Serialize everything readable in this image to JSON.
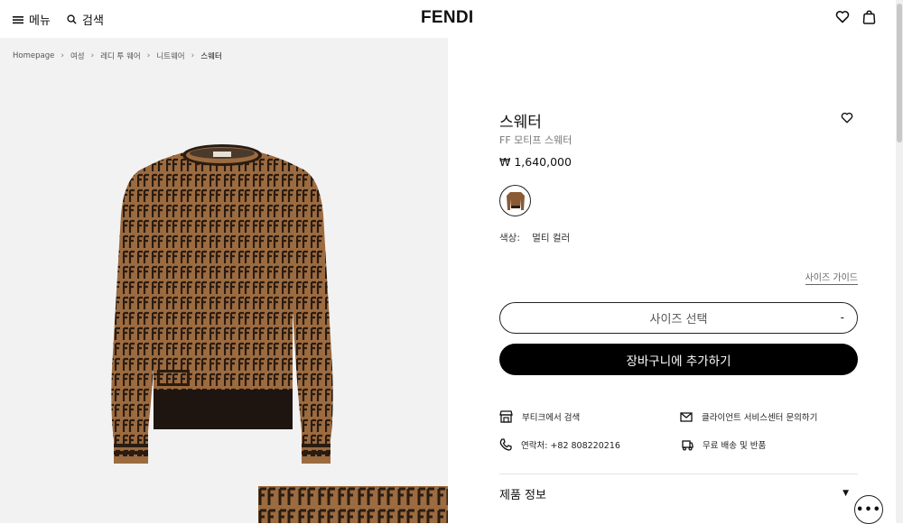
{
  "header": {
    "menu_label": "메뉴",
    "search_label": "검색",
    "logo": "FENDI",
    "icons": [
      "menu-icon",
      "search-icon",
      "heart-icon",
      "shopping-bag-icon"
    ]
  },
  "breadcrumb": [
    "Homepage",
    "여성",
    "레디 투 웨어",
    "니트웨어",
    "스웨터"
  ],
  "product": {
    "title": "스웨터",
    "subtitle": "FF 모티프 스웨터",
    "price": "₩ 1,640,000",
    "color_label": "색상:",
    "color_value": "멀티 컬러",
    "size_guide": "사이즈 가이드",
    "size_select": "사이즈 선택",
    "add_to_cart": "장바구니에 추가하기"
  },
  "services": {
    "boutique": "부티크에서 검색",
    "client_service": "클라이언트 서비스센터 문의하기",
    "contact": "연락처: +82 808220216",
    "shipping": "무료 배송 및 반품"
  },
  "info": {
    "product_info": "제품 정보"
  },
  "chat_label": "•••",
  "colors": {
    "accent": "#000000",
    "brown": "#9a6a3f",
    "dark": "#2b1d12"
  }
}
